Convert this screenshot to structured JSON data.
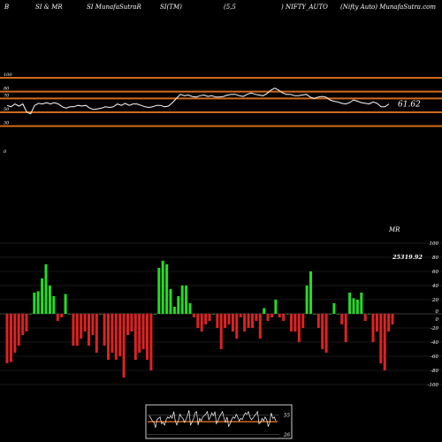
{
  "header": {
    "col1": "B",
    "col2": "SI & MR",
    "col3": "SI MunafaSutraR",
    "col4": "SI(TM)",
    "col5": "(5,5",
    "col6": ") NIFTY_AUTO",
    "col7": "(Nifty Auto) MunafaSutra.com"
  },
  "colors": {
    "background": "#000000",
    "band_lines": "#d2691e",
    "rsi_line": "#ffffff",
    "bar_positive": "#22dd22",
    "bar_negative": "#dd2222",
    "mini_line": "#d2691e"
  },
  "chart_data": [
    {
      "type": "line",
      "title": "",
      "y_ticks": [
        "100",
        "80",
        "70",
        "50",
        "30",
        "0"
      ],
      "bands": [
        100,
        80,
        70,
        50,
        30,
        0
      ],
      "last_value_label": "61.62",
      "ylim": [
        0,
        100
      ],
      "values": [
        60,
        58,
        62,
        59,
        62,
        50,
        48,
        60,
        63,
        62,
        64,
        62,
        64,
        62,
        58,
        56,
        58,
        58,
        60,
        59,
        60,
        56,
        54,
        55,
        56,
        58,
        57,
        58,
        62,
        60,
        63,
        60,
        62,
        62,
        60,
        58,
        57,
        58,
        60,
        60,
        58,
        59,
        64,
        70,
        76,
        74,
        75,
        73,
        72,
        74,
        75,
        73,
        74,
        72,
        72,
        73,
        75,
        76,
        76,
        74,
        73,
        76,
        78,
        76,
        75,
        74,
        77,
        82,
        85,
        82,
        78,
        76,
        76,
        74,
        74,
        75,
        76,
        72,
        70,
        72,
        73,
        72,
        68,
        66,
        65,
        63,
        62,
        64,
        68,
        66,
        64,
        63,
        62,
        65,
        63,
        58,
        58,
        62
      ]
    },
    {
      "type": "bar",
      "title": "MR",
      "value_label": "25319.92",
      "y_ticks": [
        "100",
        "80",
        "60",
        "40",
        "20",
        "0",
        "0",
        "-20",
        "-40",
        "-60",
        "-80",
        "-100"
      ],
      "ylim": [
        -100,
        100
      ],
      "values": [
        -70,
        -68,
        -55,
        -45,
        -30,
        -25,
        0,
        30,
        32,
        50,
        70,
        40,
        25,
        -10,
        -5,
        28,
        0,
        -45,
        -45,
        -35,
        -25,
        -45,
        -30,
        -55,
        0,
        -45,
        -65,
        -55,
        -65,
        -60,
        -90,
        -30,
        -25,
        -65,
        -55,
        -50,
        -65,
        -80,
        0,
        65,
        75,
        70,
        35,
        10,
        25,
        40,
        40,
        15,
        -5,
        -20,
        -25,
        -15,
        -10,
        0,
        -20,
        -50,
        -20,
        -15,
        -25,
        -35,
        -5,
        -25,
        -20,
        -20,
        -10,
        -35,
        8,
        -10,
        -5,
        20,
        -5,
        -10,
        0,
        -25,
        -25,
        -40,
        -20,
        40,
        60,
        0,
        -20,
        -50,
        -55,
        0,
        15,
        0,
        -15,
        -40,
        30,
        22,
        20,
        30,
        -10,
        0,
        -40,
        -25,
        -70,
        -80,
        -25,
        -15
      ]
    },
    {
      "type": "line",
      "title": "",
      "y_ticks": [
        "55",
        "26"
      ],
      "values": [
        54,
        50,
        46,
        44,
        36,
        48,
        50,
        52,
        42,
        44,
        40,
        48,
        52,
        50,
        54,
        50,
        60,
        46,
        40,
        46,
        56,
        52,
        50,
        44,
        48,
        54,
        62,
        40,
        44,
        50,
        58,
        60,
        40,
        50,
        46,
        52,
        54,
        56,
        60,
        48,
        52,
        58,
        54,
        60,
        42,
        46,
        52,
        56,
        60,
        50,
        44,
        52,
        38,
        42,
        48,
        52,
        50,
        56,
        52,
        46,
        50,
        48,
        54,
        58,
        56,
        60,
        52,
        48,
        50,
        54,
        56,
        60,
        42,
        44,
        50,
        46,
        52,
        48,
        38,
        44,
        58,
        50,
        52,
        46
      ]
    }
  ]
}
